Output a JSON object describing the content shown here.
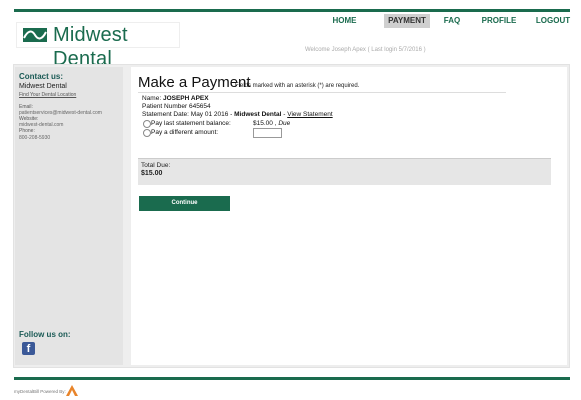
{
  "brand": {
    "name": "Midwest Dental",
    "color": "#1a6b4e"
  },
  "nav": {
    "items": [
      {
        "label": "HOME",
        "active": false
      },
      {
        "label": "PAYMENT",
        "active": true
      },
      {
        "label": "FAQ",
        "active": false
      },
      {
        "label": "PROFILE",
        "active": false
      },
      {
        "label": "LOGOUT",
        "active": false
      }
    ]
  },
  "welcome": "Welcome Joseph Apex ( Last login 5/7/2016 )",
  "sidebar": {
    "contact_title": "Contact us:",
    "practice_name": "Midwest Dental",
    "find_link": "Find Your Dental Location",
    "email_label": "Email:",
    "email_value": "patientservices@midwest-dental.com",
    "website_label": "Website:",
    "website_value": "midwest-dental.com",
    "phone_label": "Phone:",
    "phone_value": "800-208-5930",
    "follow_title": "Follow us on:",
    "facebook_icon": "facebook-icon"
  },
  "payment": {
    "title": "Make a Payment",
    "note": "Fields marked with an asterisk (*) are required.",
    "name_label": "Name:",
    "name_value": "JOSEPH APEX",
    "patient_number": "Patient Number 645654",
    "statement_date": "Statement Date: May 01 2016 - ",
    "statement_practice": "Midwest Dental",
    "statement_sep": " - ",
    "view_statement": "View Statement",
    "option_last_balance": "Pay last statement balance:",
    "option_different": "Pay a different amount:",
    "balance_amount": "$15.00",
    "balance_sep": " , ",
    "balance_status": "Due",
    "amount_placeholder": "",
    "total_label": "Total Due:",
    "total_value": "$15.00",
    "continue_label": "Continue"
  },
  "footer": {
    "text": "myDentalBill Powered By:"
  }
}
